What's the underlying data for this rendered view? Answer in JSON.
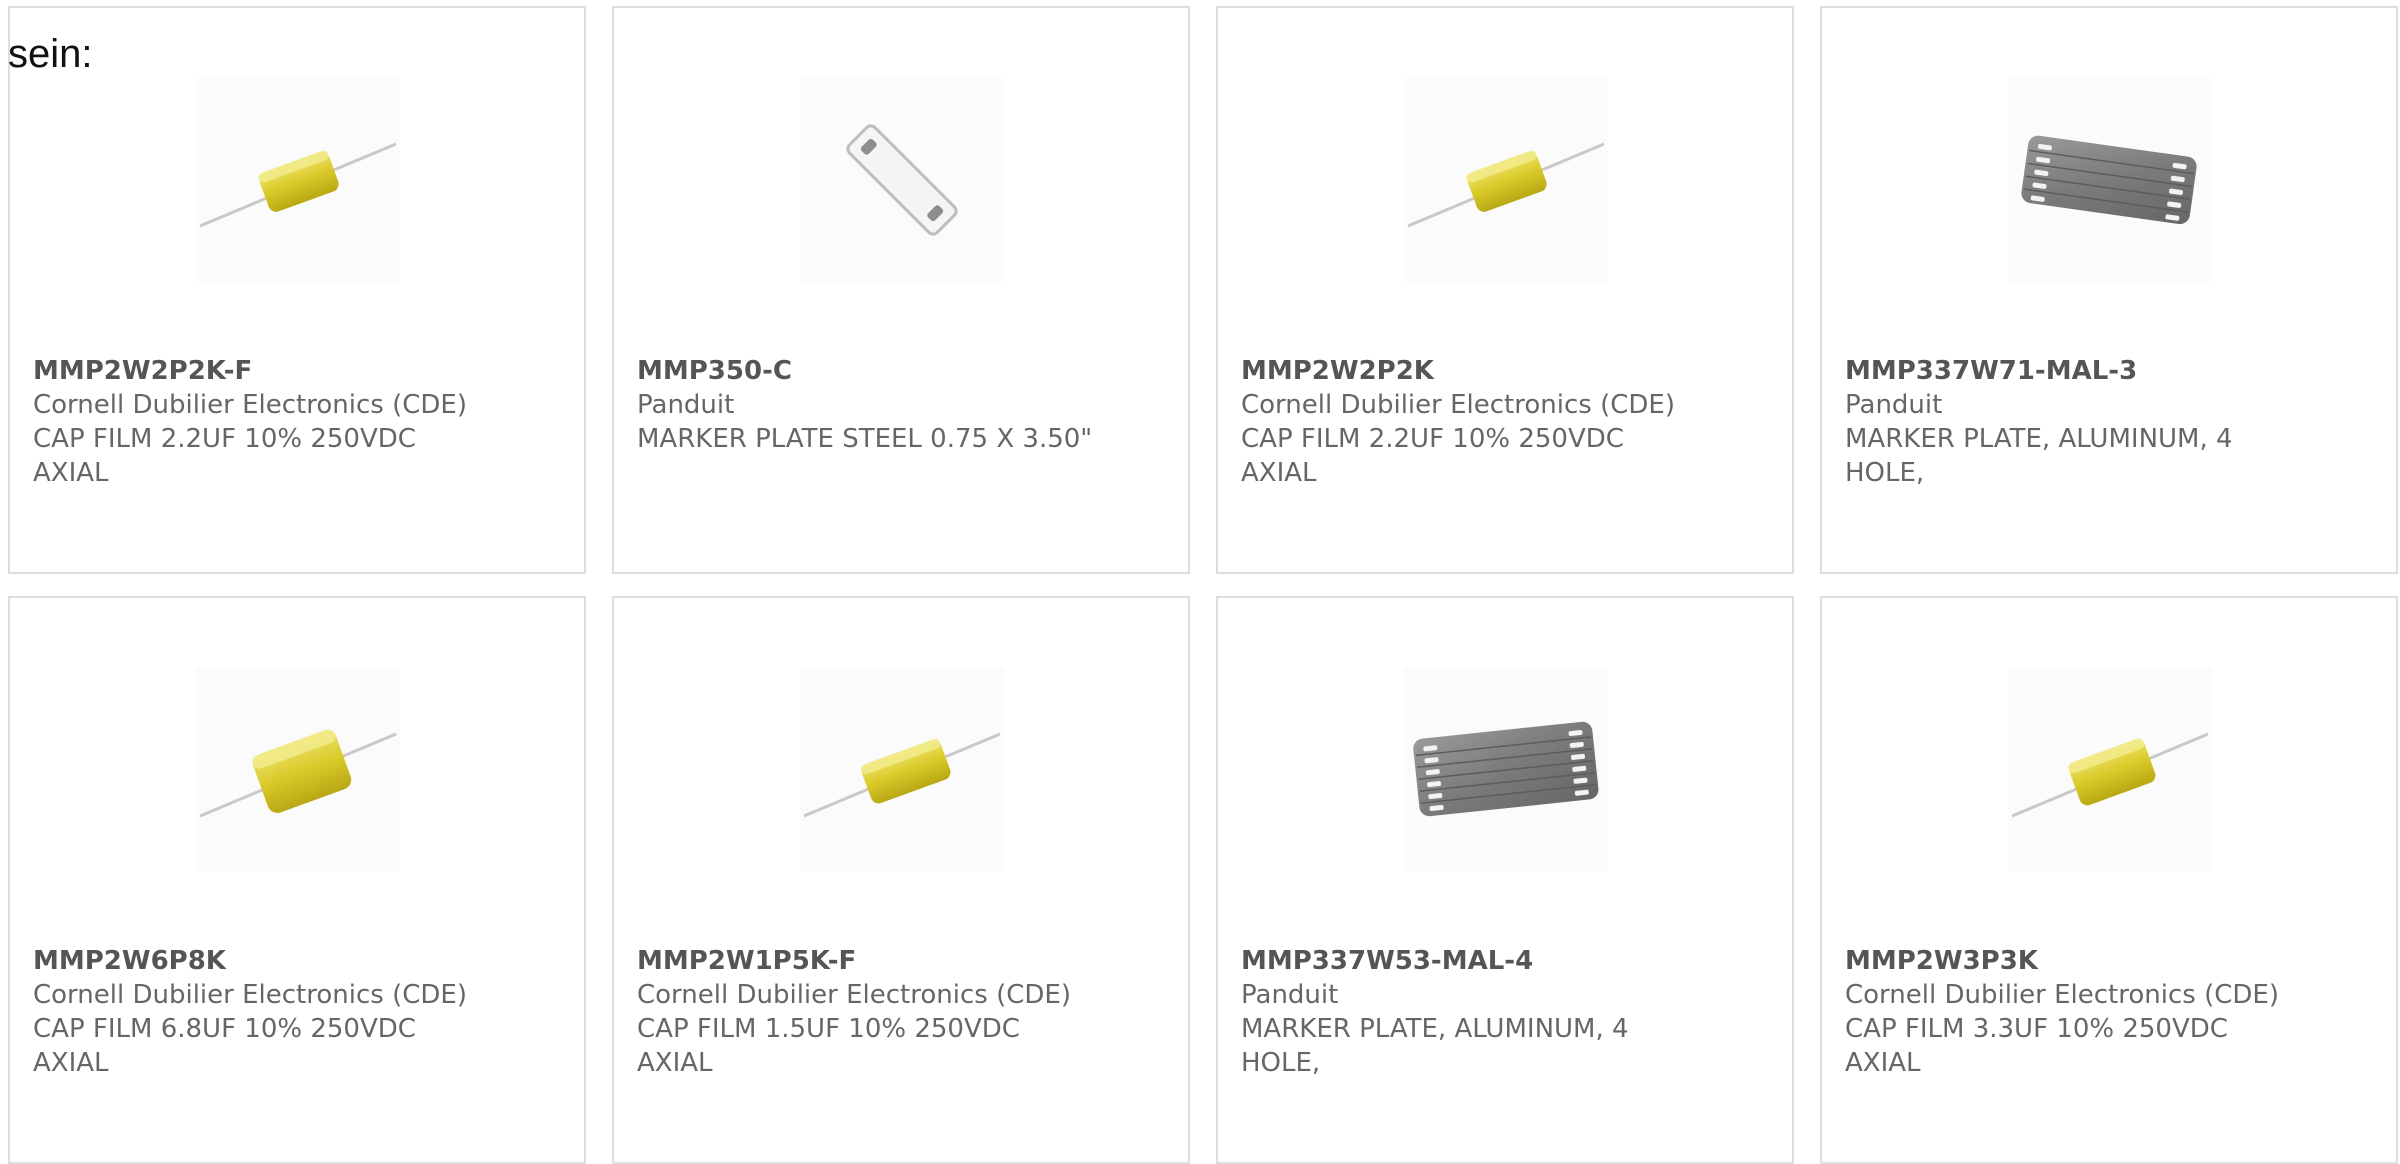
{
  "intro_text": "sein:",
  "colors": {
    "accent": "#e13b12",
    "bar_dark": "#3d3d3d",
    "card_border": "#dedede",
    "text_gray": "#666666"
  },
  "products": [
    {
      "part_number": "MMP2W2P2K-F",
      "manufacturer": "Cornell Dubilier Electronics (CDE)",
      "description": "CAP FILM 2.2UF 10% 250VDC AXIAL",
      "image": "yellow-axial-capacitor"
    },
    {
      "part_number": "MMP350-C",
      "manufacturer": "Panduit",
      "description": "MARKER PLATE STEEL 0.75 X 3.50\"",
      "image": "steel-marker-plate"
    },
    {
      "part_number": "MMP2W2P2K",
      "manufacturer": "Cornell Dubilier Electronics (CDE)",
      "description": "CAP FILM 2.2UF 10% 250VDC AXIAL",
      "image": "yellow-axial-capacitor"
    },
    {
      "part_number": "MMP337W71-MAL-3",
      "manufacturer": "Panduit",
      "description": "MARKER PLATE, ALUMINUM, 4 HOLE,",
      "image": "aluminum-marker-plate-strip"
    },
    {
      "part_number": "MMP2W6P8K",
      "manufacturer": "Cornell Dubilier Electronics (CDE)",
      "description": "CAP FILM 6.8UF 10% 250VDC AXIAL",
      "image": "yellow-axial-capacitor-large"
    },
    {
      "part_number": "MMP2W1P5K-F",
      "manufacturer": "Cornell Dubilier Electronics (CDE)",
      "description": "CAP FILM 1.5UF 10% 250VDC AXIAL",
      "image": "yellow-axial-capacitor"
    },
    {
      "part_number": "MMP337W53-MAL-4",
      "manufacturer": "Panduit",
      "description": "MARKER PLATE, ALUMINUM, 4 HOLE,",
      "image": "aluminum-marker-plate-strip"
    },
    {
      "part_number": "MMP2W3P3K",
      "manufacturer": "Cornell Dubilier Electronics (CDE)",
      "description": "CAP FILM 3.3UF 10% 250VDC AXIAL",
      "image": "yellow-axial-capacitor"
    }
  ]
}
